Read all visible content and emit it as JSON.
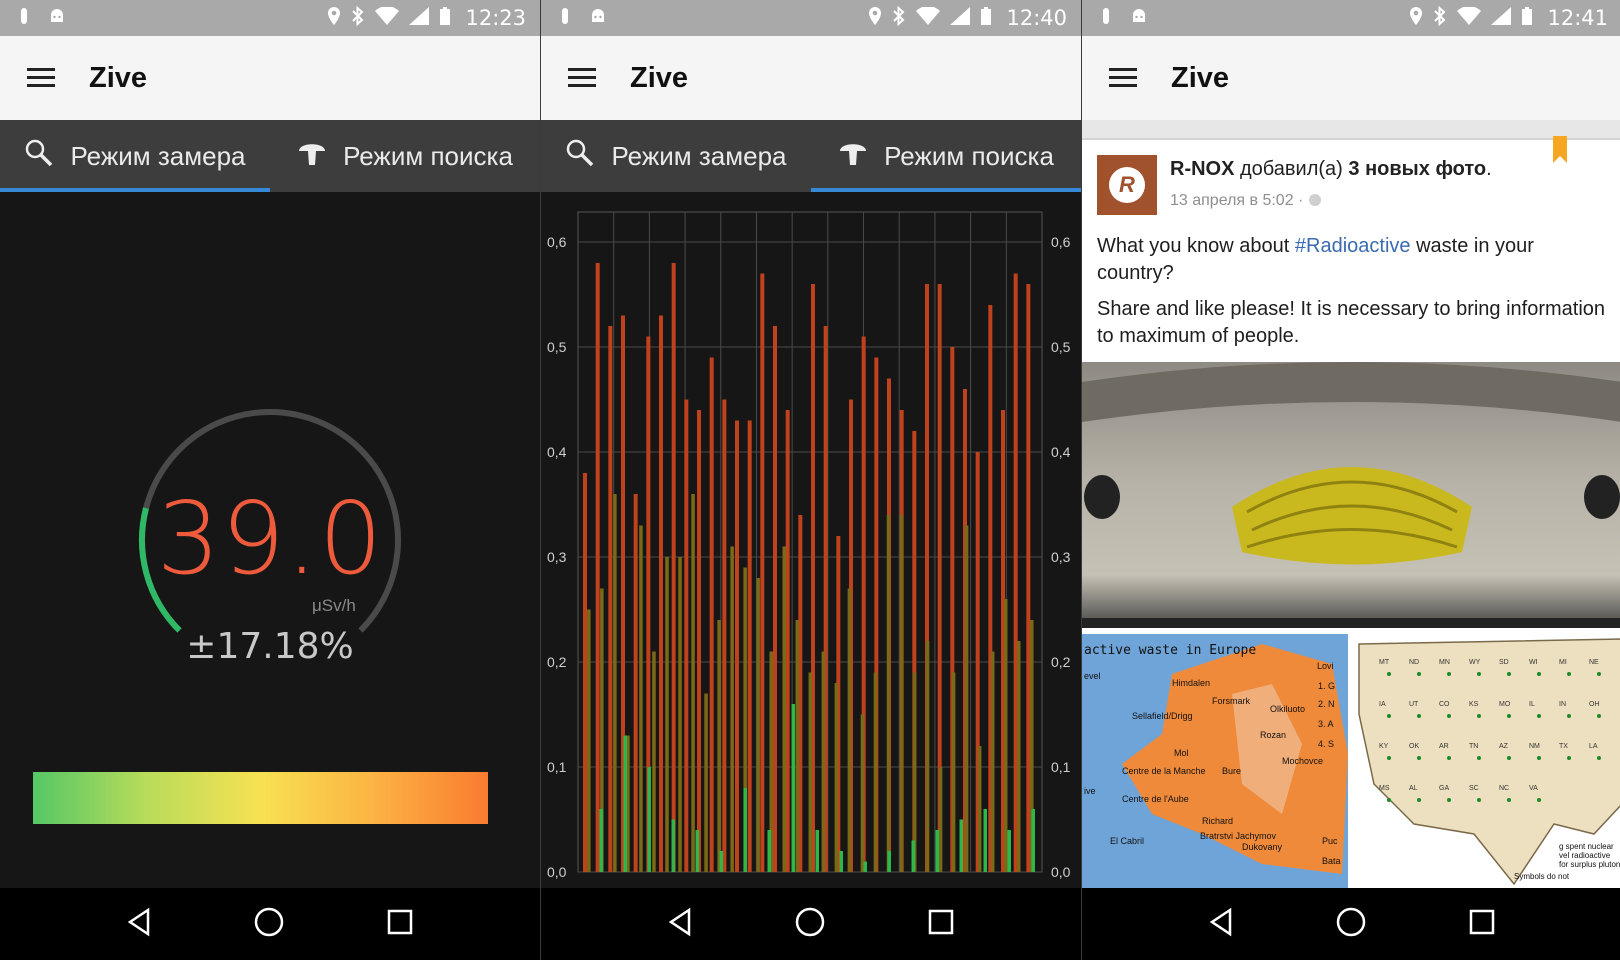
{
  "screens": [
    {
      "status_time": "12:23",
      "app_title": "Zive",
      "tabs": [
        {
          "label": "Режим замера",
          "icon": "search-icon",
          "active": true
        },
        {
          "label": "Режим поиска",
          "icon": "mushroom-icon",
          "active": false
        }
      ],
      "gauge": {
        "value": "39.0",
        "unit": "μSv/h",
        "error": "±17.18%",
        "level_fraction": 0.22
      },
      "colors": {
        "accent": "#3589d6",
        "reading": "#ee5b3c",
        "gauge_fill": "#2fb865"
      }
    },
    {
      "status_time": "12:40",
      "app_title": "Zive",
      "tabs": [
        {
          "label": "Режим замера",
          "icon": "search-icon",
          "active": false
        },
        {
          "label": "Режим поиска",
          "icon": "mushroom-icon",
          "active": true
        }
      ]
    },
    {
      "status_time": "12:41",
      "app_title": "Zive",
      "post": {
        "author": "R-NOX",
        "action": "добавил(а)",
        "object": "3 новых фото",
        "time": "13 апреля в 5:02 ·",
        "line1_pre": "What you know about",
        "hashtag": "#Radioactive",
        "line1_post": "waste in your country?",
        "line2": "Share and like please! It is necessary to bring information to maximum of people."
      },
      "map_left": {
        "title": "active waste in Europe",
        "labels": [
          "evel",
          "Himdalen",
          "Forsmark",
          "Olkiluoto",
          "Sellafield/Drigg",
          "Rozan",
          "Mol",
          "Centre de la Manche",
          "Bure",
          "Mochovce",
          "Centre de l'Aube",
          "ive",
          "Richard",
          "El Cabril",
          "Bratrstvi Jachymov",
          "Dukovany",
          "Puc",
          "Bata",
          "Lovi",
          "1. G",
          "2. N",
          "3. A",
          "4. S"
        ]
      },
      "map_right": {
        "labels": [
          "g spent nuclear",
          "vel radioactive",
          "for surplus plutonium",
          "Symbols do not"
        ],
        "states": [
          "MT",
          "ND",
          "MN",
          "WY",
          "SD",
          "WI",
          "MI",
          "NE",
          "IA",
          "UT",
          "CO",
          "KS",
          "MO",
          "IL",
          "IN",
          "OH",
          "KY",
          "OK",
          "AR",
          "TN",
          "AZ",
          "NM",
          "TX",
          "LA",
          "MS",
          "AL",
          "GA",
          "SC",
          "NC",
          "VA"
        ]
      }
    }
  ],
  "chart_data": {
    "type": "bar",
    "title": "",
    "xlabel": "",
    "ylabel": "",
    "ylim": [
      0,
      0.6
    ],
    "yticks": [
      "0,0",
      "0,1",
      "0,2",
      "0,3",
      "0,4",
      "0,5",
      "0,6"
    ],
    "grid": true,
    "series": [
      {
        "color": "#c0421d",
        "values": [
          0.38,
          0.58,
          0.52,
          0.53,
          0.36,
          0.51,
          0.53,
          0.58,
          0.45,
          0.44,
          0.49,
          0.45,
          0.43,
          0.43,
          0.57,
          0.52,
          0.44,
          0.34,
          0.56,
          0.52,
          0.32,
          0.45,
          0.51,
          0.49,
          0.47,
          0.44,
          0.42,
          0.56,
          0.56,
          0.5,
          0.46,
          0.4,
          0.54,
          0.44,
          0.57,
          0.56
        ],
        "offsets": [
          0.37,
          0.56,
          0.46,
          0.52,
          0.32,
          0.5,
          0.52,
          0.57,
          0.44,
          0.43,
          0.48,
          0.44,
          0.42,
          0.42,
          0.56,
          0.51,
          0.43,
          0.33,
          0.55,
          0.51,
          0.31,
          0.44,
          0.5,
          0.48,
          0.46,
          0.43,
          0.41,
          0.55,
          0.55,
          0.49,
          0.45,
          0.39,
          0.53,
          0.43,
          0.56,
          0.55
        ]
      },
      {
        "color": "#7a6a17",
        "values": [
          0.25,
          0.27,
          0.36,
          0.13,
          0.33,
          0.21,
          0.3,
          0.3,
          0.36,
          0.17,
          0.24,
          0.31,
          0.29,
          0.28,
          0.21,
          0.31,
          0.24,
          0.19,
          0.21,
          0.18,
          0.27,
          0.15,
          0.19,
          0.34,
          0.34,
          0.19,
          0.22,
          0.1,
          0.19,
          0.33,
          0.12,
          0.21,
          0.26,
          0.22,
          0.24
        ],
        "offsets": [
          0.24,
          0.26,
          0.35,
          0.12,
          0.32,
          0.2,
          0.29,
          0.29,
          0.35,
          0.16,
          0.23,
          0.3,
          0.28,
          0.27,
          0.2,
          0.3,
          0.23,
          0.18,
          0.2,
          0.17,
          0.26,
          0.14,
          0.18,
          0.33,
          0.33,
          0.18,
          0.21,
          0.09,
          0.18,
          0.32,
          0.11,
          0.2,
          0.25,
          0.21,
          0.23
        ]
      },
      {
        "color": "#2db84a",
        "values": [
          0.06,
          0.13,
          0.1,
          0.05,
          0.04,
          0.02,
          0.08,
          0.04,
          0.16,
          0.04,
          0.02,
          0.01,
          0.02,
          0.03,
          0.04,
          0.05,
          0.06,
          0.04,
          0.06
        ],
        "offsets": [
          0.05,
          0.12,
          0.09,
          0.04,
          0.03,
          0.02,
          0.07,
          0.03,
          0.15,
          0.03,
          0.01,
          0.01,
          0.01,
          0.02,
          0.03,
          0.04,
          0.05,
          0.03,
          0.05
        ]
      }
    ]
  },
  "navbar": {
    "items": [
      "back-icon",
      "home-icon",
      "recents-icon"
    ]
  }
}
